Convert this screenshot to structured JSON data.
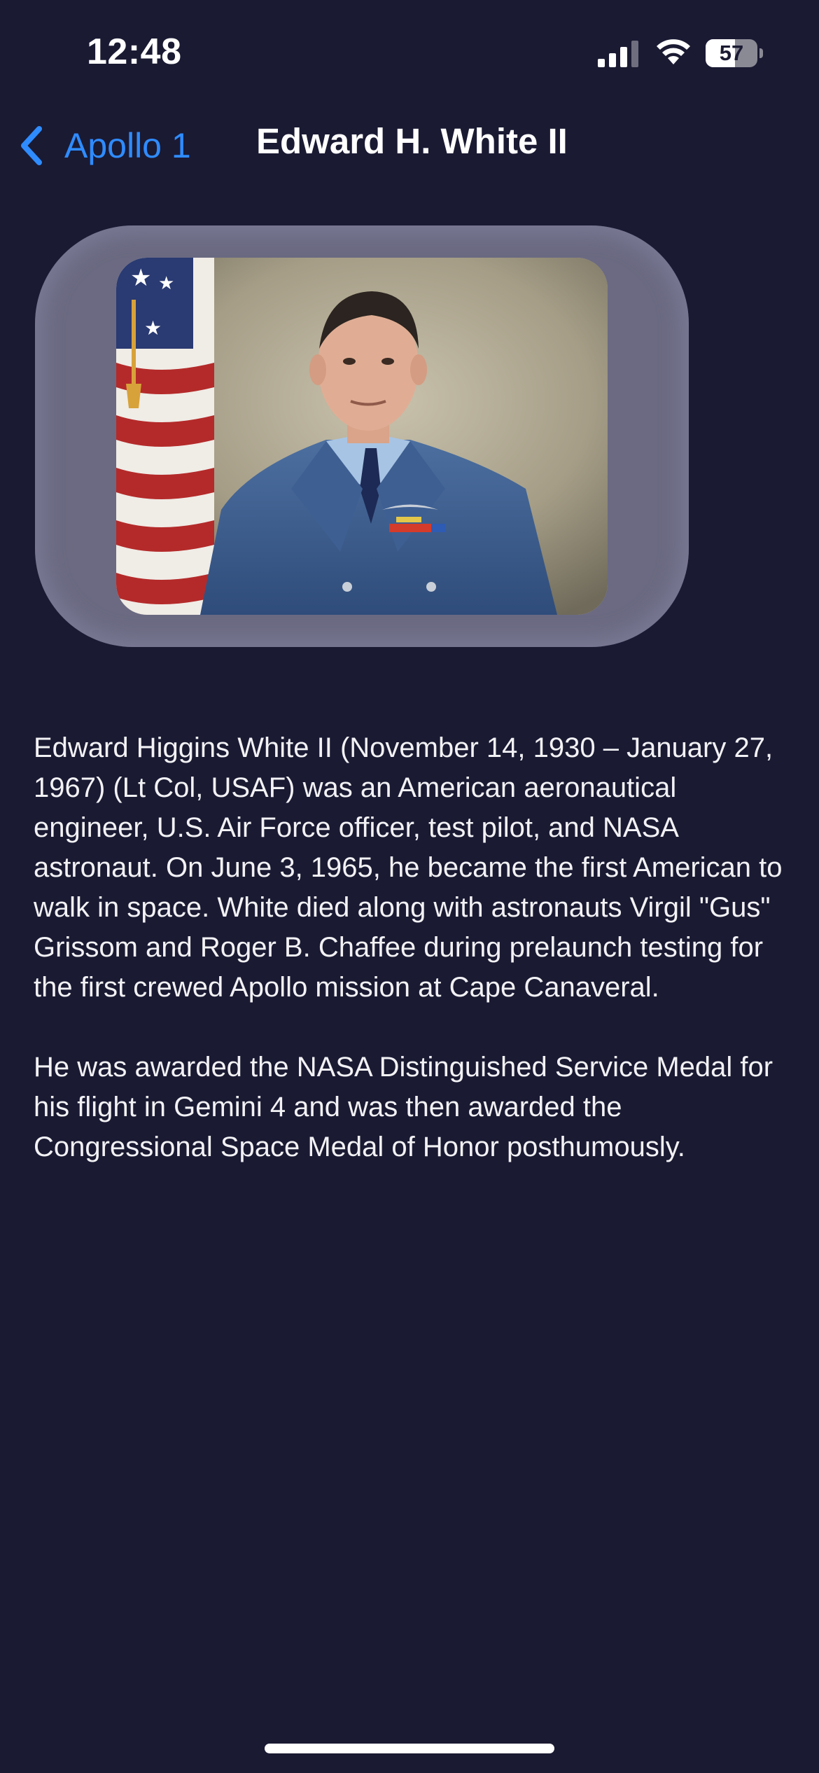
{
  "status_bar": {
    "time": "12:48",
    "battery_level": "57",
    "battery_fraction": 0.57,
    "signal_icon": "cellular-signal-icon",
    "wifi_icon": "wifi-icon"
  },
  "nav": {
    "back_icon": "chevron-left-icon",
    "back_label": "Apollo 1",
    "title": "Edward H. White II"
  },
  "photo": {
    "description_icon": "astronaut-portrait-photo"
  },
  "bio": {
    "paragraphs": [
      "Edward Higgins White II (November 14, 1930 – January 27, 1967) (Lt Col, USAF) was an American aeronautical engineer, U.S. Air Force officer, test pilot, and NASA astronaut. On June 3, 1965, he became the first American to walk in space. White died along with astronauts Virgil \"Gus\" Grissom and Roger B. Chaffee during prelaunch testing for the first crewed Apollo mission at Cape Canaveral.",
      "He was awarded the NASA Distinguished Service Medal for his flight in Gemini 4 and was then awarded the Congressional Space Medal of Honor posthumously."
    ]
  },
  "colors": {
    "background": "#1a1a33",
    "accent": "#2f8cff",
    "frame": "#6b6a82",
    "text": "#f2f2f5"
  }
}
